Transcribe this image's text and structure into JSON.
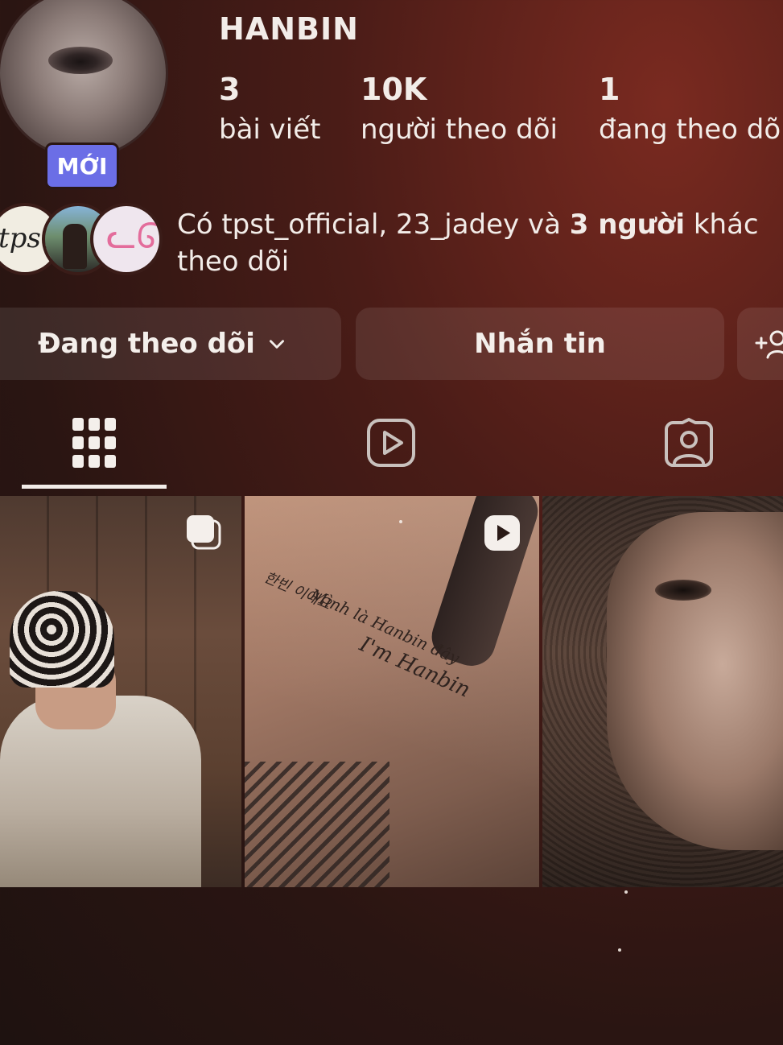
{
  "profile": {
    "username": "HANBIN",
    "new_badge": "MỚI",
    "stats": [
      {
        "value": "3",
        "label": "bài viết"
      },
      {
        "value": "10K",
        "label": "người theo dõi"
      },
      {
        "value": "1",
        "label": "đang theo dõi"
      }
    ]
  },
  "mutual": {
    "prefix": "Có tpst_official, 23_jadey và ",
    "bold": "3 người",
    "suffix": " khác theo dõi",
    "avatar1_text": "tpst"
  },
  "actions": {
    "following_label": "Đang theo dõi",
    "message_label": "Nhắn tin"
  },
  "tabs": [
    "grid",
    "reels",
    "tagged"
  ],
  "posts": {
    "post2_lines": [
      "한빈 이에요",
      "Mình là Hanbin đây",
      "I'm Hanbin"
    ]
  },
  "icons": {
    "dropdown": "chevron-down-icon",
    "add_user": "add-user-icon",
    "grid": "grid-icon",
    "reels": "reels-icon",
    "tagged": "tagged-icon",
    "carousel": "carousel-icon",
    "video": "video-icon"
  }
}
